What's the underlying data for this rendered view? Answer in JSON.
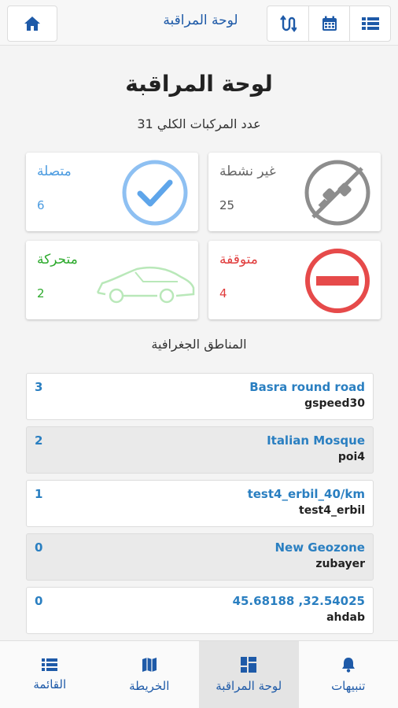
{
  "header": {
    "title": "لوحة المراقبة",
    "home_icon": "home-icon",
    "list_icon": "list-icon",
    "calendar_icon": "calendar-icon",
    "route_icon": "route-icon"
  },
  "page": {
    "title": "لوحة المراقبة",
    "total_label": "عدد المركبات الكلي 31"
  },
  "cards": {
    "connected": {
      "label": "متصلة",
      "value": "6",
      "color": "#4b9be0",
      "icon": "checkmark-circle-icon"
    },
    "inactive": {
      "label": "غير نشطة",
      "value": "25",
      "color": "#777777",
      "icon": "unplugged-icon"
    },
    "moving": {
      "label": "متحركة",
      "value": "2",
      "color": "#2eaa2e",
      "icon": "car-icon"
    },
    "stopped": {
      "label": "متوقفة",
      "value": "4",
      "color": "#e03c3c",
      "icon": "no-entry-icon"
    }
  },
  "geozones": {
    "title": "المناطق الجغرافية",
    "rows": [
      {
        "name": "Basra round road",
        "sub": "gspeed30",
        "count": "3"
      },
      {
        "name": "Italian Mosque",
        "sub": "poi4",
        "count": "2"
      },
      {
        "name": "test4_erbil_40/km",
        "sub": "test4_erbil",
        "count": "1"
      },
      {
        "name": "New Geozone",
        "sub": "zubayer",
        "count": "0"
      },
      {
        "name": "45.68188 ,32.54025",
        "sub": "ahdab",
        "count": "0"
      }
    ]
  },
  "nav": {
    "items": [
      {
        "label": "القائمة",
        "icon": "list-icon"
      },
      {
        "label": "الخريطة",
        "icon": "map-icon"
      },
      {
        "label": "لوحة المراقبة",
        "icon": "dashboard-icon"
      },
      {
        "label": "تنبيهات",
        "icon": "bell-icon"
      }
    ]
  }
}
